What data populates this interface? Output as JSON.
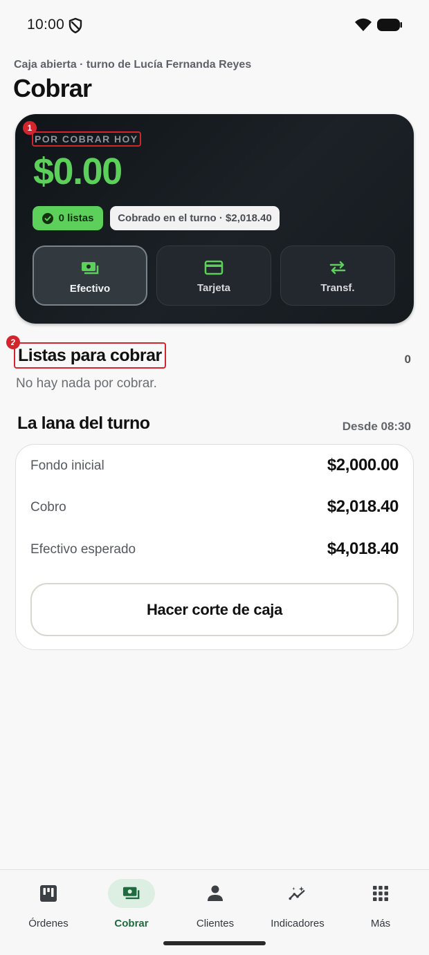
{
  "status_bar": {
    "time": "10:00"
  },
  "header": {
    "subtitle": "Caja abierta · turno de Lucía Fernanda Reyes",
    "title": "Cobrar"
  },
  "pay_card": {
    "label": "POR COBRAR HOY",
    "amount": "$0.00",
    "ready_pill": "0 listas",
    "collected_pill": "Cobrado en el turno · $2,018.40",
    "methods": [
      {
        "label": "Efectivo",
        "icon": "cash-icon",
        "selected": true
      },
      {
        "label": "Tarjeta",
        "icon": "credit-card-icon",
        "selected": false
      },
      {
        "label": "Transf.",
        "icon": "transfer-arrows-icon",
        "selected": false
      }
    ],
    "accent_color": "#5cd05a"
  },
  "markers": [
    "1",
    "2"
  ],
  "ready_section": {
    "title": "Listas para cobrar",
    "count": "0",
    "empty_text": "No hay nada por cobrar."
  },
  "shift_section": {
    "title": "La lana del turno",
    "since": "Desde 08:30",
    "rows": [
      {
        "label": "Fondo inicial",
        "value": "$2,000.00"
      },
      {
        "label": "Cobro",
        "value": "$2,018.40"
      },
      {
        "label": "Efectivo esperado",
        "value": "$4,018.40"
      }
    ],
    "close_button": "Hacer corte de caja"
  },
  "bottom_nav": {
    "items": [
      {
        "label": "Órdenes",
        "icon": "orders-board-icon",
        "active": false
      },
      {
        "label": "Cobrar",
        "icon": "cash-register-icon",
        "active": true
      },
      {
        "label": "Clientes",
        "icon": "person-icon",
        "active": false
      },
      {
        "label": "Indicadores",
        "icon": "trend-sparkle-icon",
        "active": false
      },
      {
        "label": "Más",
        "icon": "grid-dots-icon",
        "active": false
      }
    ],
    "active_color": "#1d6b3f"
  }
}
